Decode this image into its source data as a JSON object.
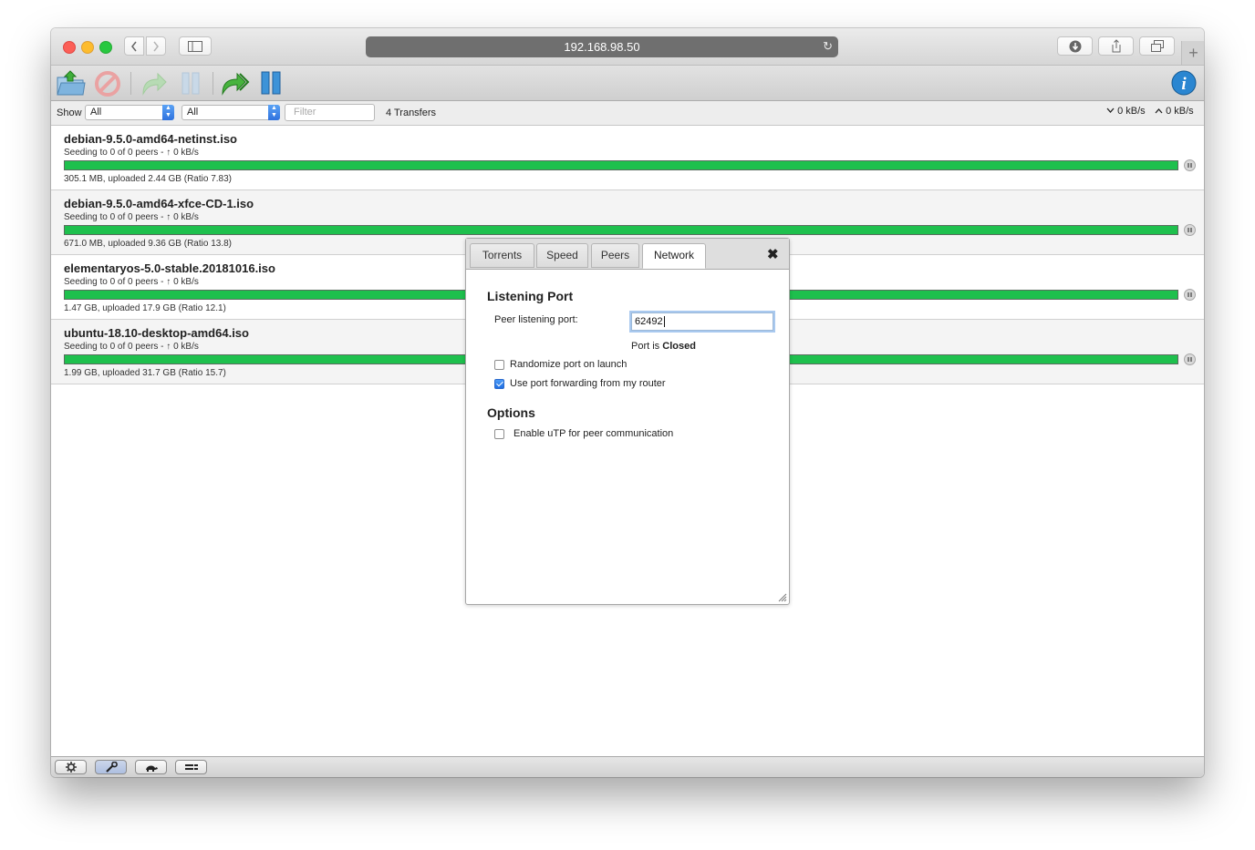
{
  "browser": {
    "url": "192.168.98.50"
  },
  "filters": {
    "show_label": "Show",
    "state_value": "All",
    "tracker_value": "All",
    "filter_placeholder": "Filter",
    "transfer_count": "4 Transfers",
    "download_speed": "0 kB/s",
    "upload_speed": "0 kB/s"
  },
  "torrents": [
    {
      "name": "debian-9.5.0-amd64-netinst.iso",
      "status": "Seeding to 0 of 0 peers - ↑ 0 kB/s",
      "info": "305.1 MB, uploaded 2.44 GB (Ratio 7.83)",
      "progress": 1.0
    },
    {
      "name": "debian-9.5.0-amd64-xfce-CD-1.iso",
      "status": "Seeding to 0 of 0 peers - ↑ 0 kB/s",
      "info": "671.0 MB, uploaded 9.36 GB (Ratio 13.8)",
      "progress": 1.0
    },
    {
      "name": "elementaryos-5.0-stable.20181016.iso",
      "status": "Seeding to 0 of 0 peers - ↑ 0 kB/s",
      "info": "1.47 GB, uploaded 17.9 GB (Ratio 12.1)",
      "progress": 1.0
    },
    {
      "name": "ubuntu-18.10-desktop-amd64.iso",
      "status": "Seeding to 0 of 0 peers - ↑ 0 kB/s",
      "info": "1.99 GB, uploaded 31.7 GB (Ratio 15.7)",
      "progress": 1.0
    }
  ],
  "preferences": {
    "tabs": [
      "Torrents",
      "Speed",
      "Peers",
      "Network"
    ],
    "selected_tab": "Network",
    "close_label": "✖",
    "listening_port_title": "Listening Port",
    "peer_port_label": "Peer listening port:",
    "peer_port_value": "62492",
    "port_status_prefix": "Port is",
    "port_status_value": "Closed",
    "randomize_label": "Randomize port on launch",
    "randomize_checked": false,
    "port_forwarding_label": "Use port forwarding from my router",
    "port_forwarding_checked": true,
    "options_title": "Options",
    "utp_label": "Enable uTP for peer communication",
    "utp_checked": false
  },
  "colors": {
    "progress_green": "#1ec04d",
    "accent_blue": "#2f72de"
  }
}
